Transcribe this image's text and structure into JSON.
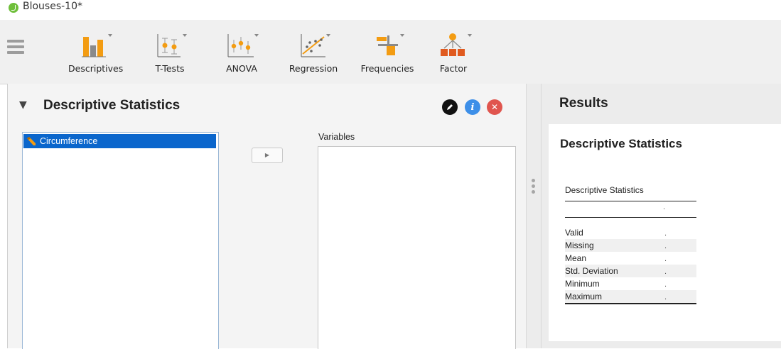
{
  "window": {
    "title": "Blouses-10*"
  },
  "ribbon": {
    "buttons": [
      {
        "label": "Descriptives",
        "icon": "descriptives-bar-chart-icon"
      },
      {
        "label": "T-Tests",
        "icon": "t-tests-icon"
      },
      {
        "label": "ANOVA",
        "icon": "anova-icon"
      },
      {
        "label": "Regression",
        "icon": "regression-scatter-icon"
      },
      {
        "label": "Frequencies",
        "icon": "frequencies-icon"
      },
      {
        "label": "Factor",
        "icon": "factor-icon"
      }
    ]
  },
  "analysis": {
    "title": "Descriptive Statistics",
    "source_variables": [
      "Circumference"
    ],
    "variables_label": "Variables",
    "variables": []
  },
  "results": {
    "title": "Results",
    "heading": "Descriptive Statistics",
    "table": {
      "caption": "Descriptive Statistics",
      "column_header": ".",
      "rows": [
        {
          "name": "Valid",
          "value": "."
        },
        {
          "name": "Missing",
          "value": "."
        },
        {
          "name": "Mean",
          "value": "."
        },
        {
          "name": "Std. Deviation",
          "value": "."
        },
        {
          "name": "Minimum",
          "value": "."
        },
        {
          "name": "Maximum",
          "value": "."
        }
      ]
    }
  },
  "colors": {
    "selection": "#0a66cc",
    "edit_icon": "#111111",
    "info_icon": "#3d8fe8",
    "close_icon": "#e0554e",
    "accent_orange": "#f39c12"
  }
}
